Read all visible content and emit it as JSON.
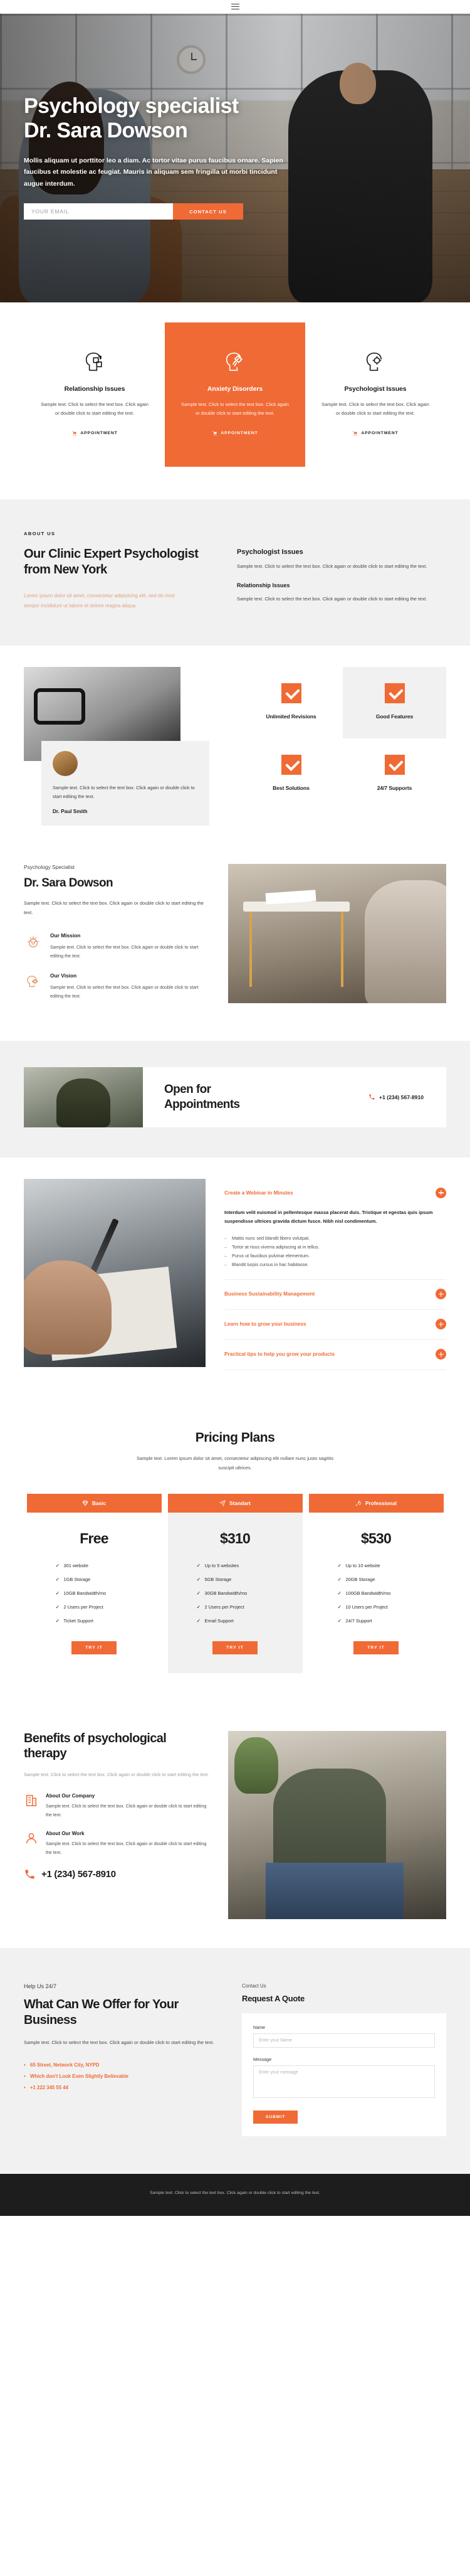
{
  "topbar": {
    "menu_icon": "hamburger-menu-icon"
  },
  "hero": {
    "title_line1": "Psychology specialist",
    "title_line2": "Dr. Sara Dowson",
    "paragraph": "Mollis aliquam ut porttitor leo a diam. Ac tortor vitae purus faucibus ornare. Sapien faucibus et molestie ac feugiat. Mauris in aliquam sem fringilla ut morbi tincidunt augue interdum.",
    "email_placeholder": "YOUR EMAIL",
    "email_value": "",
    "cta_label": "CONTACT US"
  },
  "services": {
    "cards": [
      {
        "icon": "head-puzzle-icon",
        "title": "Relationship Issues",
        "text": "Sample text. Click to select the text box. Click again or double click to start editing the text.",
        "cta": "APPOINTMENT",
        "highlight": false
      },
      {
        "icon": "head-broom-icon",
        "title": "Anxiety Disorders",
        "text": "Sample text. Click to select the text box. Click again or double click to start editing the text.",
        "cta": "APPOINTMENT",
        "highlight": true
      },
      {
        "icon": "head-gear-icon",
        "title": "Psychologist Issues",
        "text": "Sample text. Click to select the text box. Click again or double click to start editing the text.",
        "cta": "APPOINTMENT",
        "highlight": false
      }
    ]
  },
  "about": {
    "eyebrow": "ABOUT US",
    "heading": "Our Clinic Expert Psychologist from New York",
    "lead": "Lorem ipsum dolor sit amet, consectetur adipisicing elit, sed do mod tempor incididunt ut labore et dolore magna aliqua.",
    "blocks": [
      {
        "title": "Psychologist Issues",
        "text": "Sample text. Click to select the text box. Click again or double click to start editing the text."
      },
      {
        "title": "Relationship Issues",
        "text": "Sample text. Click to select the text box. Click again or double click to start editing the text."
      }
    ]
  },
  "features": {
    "quote_text": "Sample text. Click to select the text box. Click again or double click to start editing the text.",
    "quote_author": "Dr. Paul Smith",
    "cells": [
      {
        "icon": "check-icon",
        "title": "Unlimited Revisions",
        "shaded": false
      },
      {
        "icon": "check-icon",
        "title": "Good Features",
        "shaded": true
      },
      {
        "icon": "check-icon",
        "title": "Best Solutions",
        "shaded": false
      },
      {
        "icon": "check-icon",
        "title": "24/7 Supports",
        "shaded": false
      }
    ]
  },
  "doctor": {
    "kicker": "Psychology Specialist",
    "name": "Dr. Sara Dowson",
    "lead": "Sample text. Click to select the text box. Click again or double click to start editing the text.",
    "items": [
      {
        "icon": "mind-lotus-icon",
        "title": "Our Mission",
        "text": "Sample text. Click to select the text box. Click again or double click to start editing the text."
      },
      {
        "icon": "mind-eye-icon",
        "title": "Our Vision",
        "text": "Sample text. Click to select the text box. Click again or double click to start editing the text."
      }
    ]
  },
  "appointments": {
    "heading_line1": "Open for",
    "heading_line2": "Appointments",
    "phone_icon": "phone-icon",
    "phone": "+1 (234) 567-8910"
  },
  "accordion": {
    "items": [
      {
        "title": "Create a Webinar in Minutes",
        "open": true,
        "intro": "Interdum velit euismod in pellentesque massa placerat duis. Tristique et egestas quis ipsum suspendisse ultrices gravida dictum fusce. Nibh nisl condimentum.",
        "bullets": [
          "Mattis nunc sed blandit libero volutpat.",
          "Tortor at risus viverra adipiscing at in tellus.",
          "Purus ut faucibus pulvinar elementum.",
          "Blandit turpis cursus in hac habitasse."
        ]
      },
      {
        "title": "Business Sustainability Management",
        "open": false
      },
      {
        "title": "Learn how to grow your business",
        "open": false
      },
      {
        "title": "Practical tips to help you grow your products",
        "open": false
      }
    ]
  },
  "pricing": {
    "heading": "Pricing Plans",
    "subtitle": "Sample text. Lorem ipsum dolor sit amet, consectetur adipiscing elit nullam nunc justo sagittis suscipit ultrices.",
    "plans": [
      {
        "icon": "diamond-icon",
        "name": "Basic",
        "price": "Free",
        "features": [
          "301 website",
          "1GB Storage",
          "10GB Bandwidth/mo",
          "2 Users per Project",
          "Ticket Support"
        ],
        "button": "TRY IT",
        "featured": false
      },
      {
        "icon": "paper-plane-icon",
        "name": "Standart",
        "price": "$310",
        "features": [
          "Up to 5 websites",
          "5GB Storage",
          "30GB Bandwidth/mo",
          "2 Users per Project",
          "Email Support"
        ],
        "button": "TRY IT",
        "featured": true
      },
      {
        "icon": "rocket-icon",
        "name": "Professional",
        "price": "$530",
        "features": [
          "Up to 10 website",
          "20GB Storage",
          "100GB Bandwidth/mo",
          "10 Users per Project",
          "24/7 Support"
        ],
        "button": "TRY IT",
        "featured": false
      }
    ]
  },
  "benefits": {
    "heading": "Benefits of psychological therapy",
    "lead": "Sample text. Click to select the text box. Click again or double click to start editing the text.",
    "items": [
      {
        "icon": "building-icon",
        "title": "About Our Company",
        "text": "Sample text. Click to select the text box. Click again or double click to start editing the text."
      },
      {
        "icon": "user-icon",
        "title": "About Our Work",
        "text": "Sample text. Click to select the text box. Click again or double click to start editing the text."
      }
    ],
    "phone_icon": "phone-icon",
    "phone": "+1 (234) 567-8910"
  },
  "contact": {
    "kicker": "Help Us 24/7",
    "heading": "What Can We Offer for Your Business",
    "lead": "Sample text. Click to select the text box. Click again or double click to start editing the text.",
    "links": [
      "65 Street, Network City, NYPD",
      "Which don't Look Even Slightly Believable",
      "+1 222 345 55 44"
    ],
    "form_label": "Contact Us",
    "form_title": "Request A Quote",
    "fields": {
      "name_label": "Name",
      "name_placeholder": "Enter your Name",
      "name_value": "",
      "message_label": "Message",
      "message_placeholder": "Enter your message",
      "message_value": ""
    },
    "submit_label": "SUBMIT"
  },
  "footer": {
    "text": "Sample text. Click to select the text box. Click again or double click to start editing the text."
  },
  "colors": {
    "accent": "#f06a35",
    "dark": "#1d1d1d",
    "shade": "#f1f1f1"
  }
}
